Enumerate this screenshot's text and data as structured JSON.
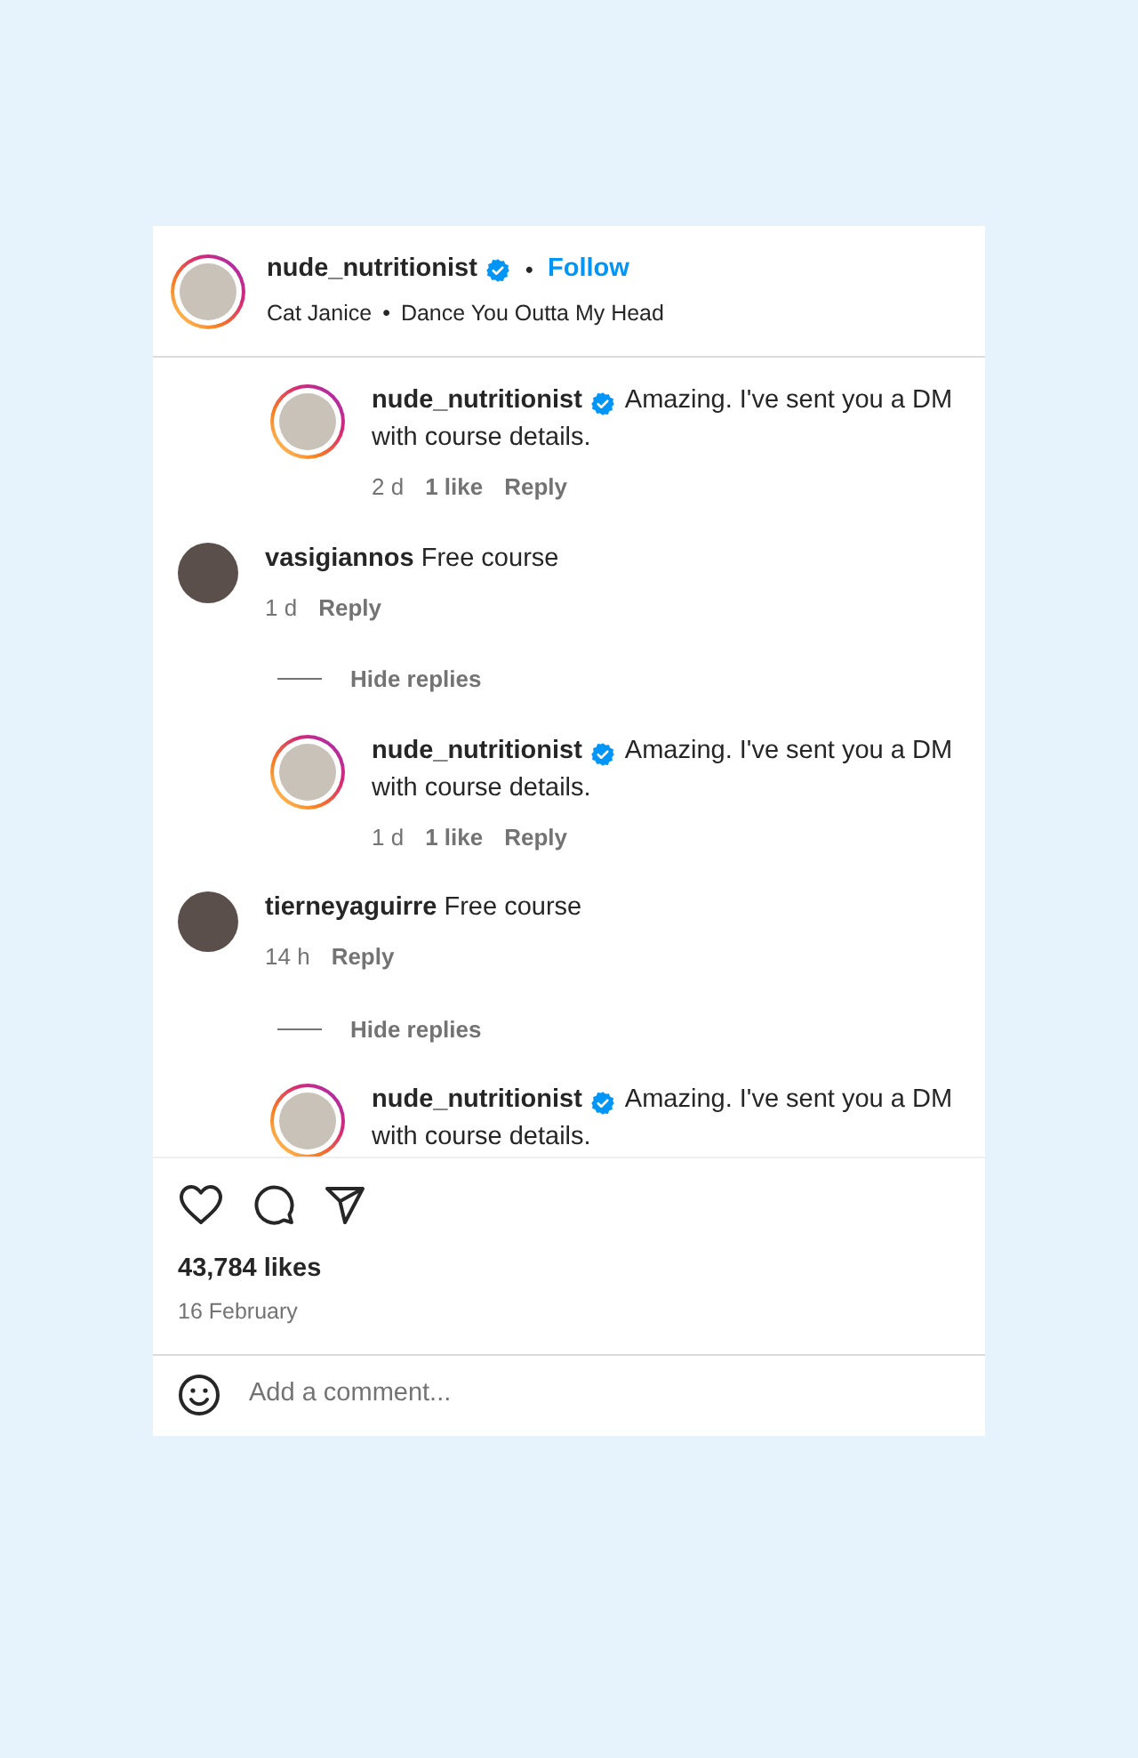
{
  "header": {
    "username": "nude_nutritionist",
    "verified": true,
    "story_ring": true,
    "separator": "•",
    "follow": "Follow",
    "audio_artist": "Cat Janice",
    "audio_separator": "•",
    "audio_title": "Dance You Outta My Head"
  },
  "comments": [
    {
      "kind": "reply",
      "username": "nude_nutritionist",
      "verified": true,
      "story_ring": true,
      "text": "Amazing. I've sent you a DM with course details.",
      "time": "2 d",
      "likes": "1 like",
      "reply": "Reply"
    },
    {
      "kind": "comment",
      "username": "vasigiannos",
      "verified": false,
      "story_ring": false,
      "text": "Free course",
      "time": "1 d",
      "reply": "Reply"
    },
    {
      "kind": "toggle",
      "label": "Hide replies"
    },
    {
      "kind": "reply",
      "username": "nude_nutritionist",
      "verified": true,
      "story_ring": true,
      "text": "Amazing. I've sent you a DM with course details.",
      "time": "1 d",
      "likes": "1 like",
      "reply": "Reply"
    },
    {
      "kind": "comment",
      "username": "tierneyaguirre",
      "verified": false,
      "story_ring": false,
      "text": "Free course",
      "time": "14 h",
      "reply": "Reply"
    },
    {
      "kind": "toggle",
      "label": "Hide replies"
    },
    {
      "kind": "reply",
      "username": "nude_nutritionist",
      "verified": true,
      "story_ring": true,
      "text": "Amazing. I've sent you a DM with course details."
    }
  ],
  "likes": "43,784 likes",
  "date": "16 February",
  "comment_field": {
    "placeholder": "Add a comment..."
  }
}
